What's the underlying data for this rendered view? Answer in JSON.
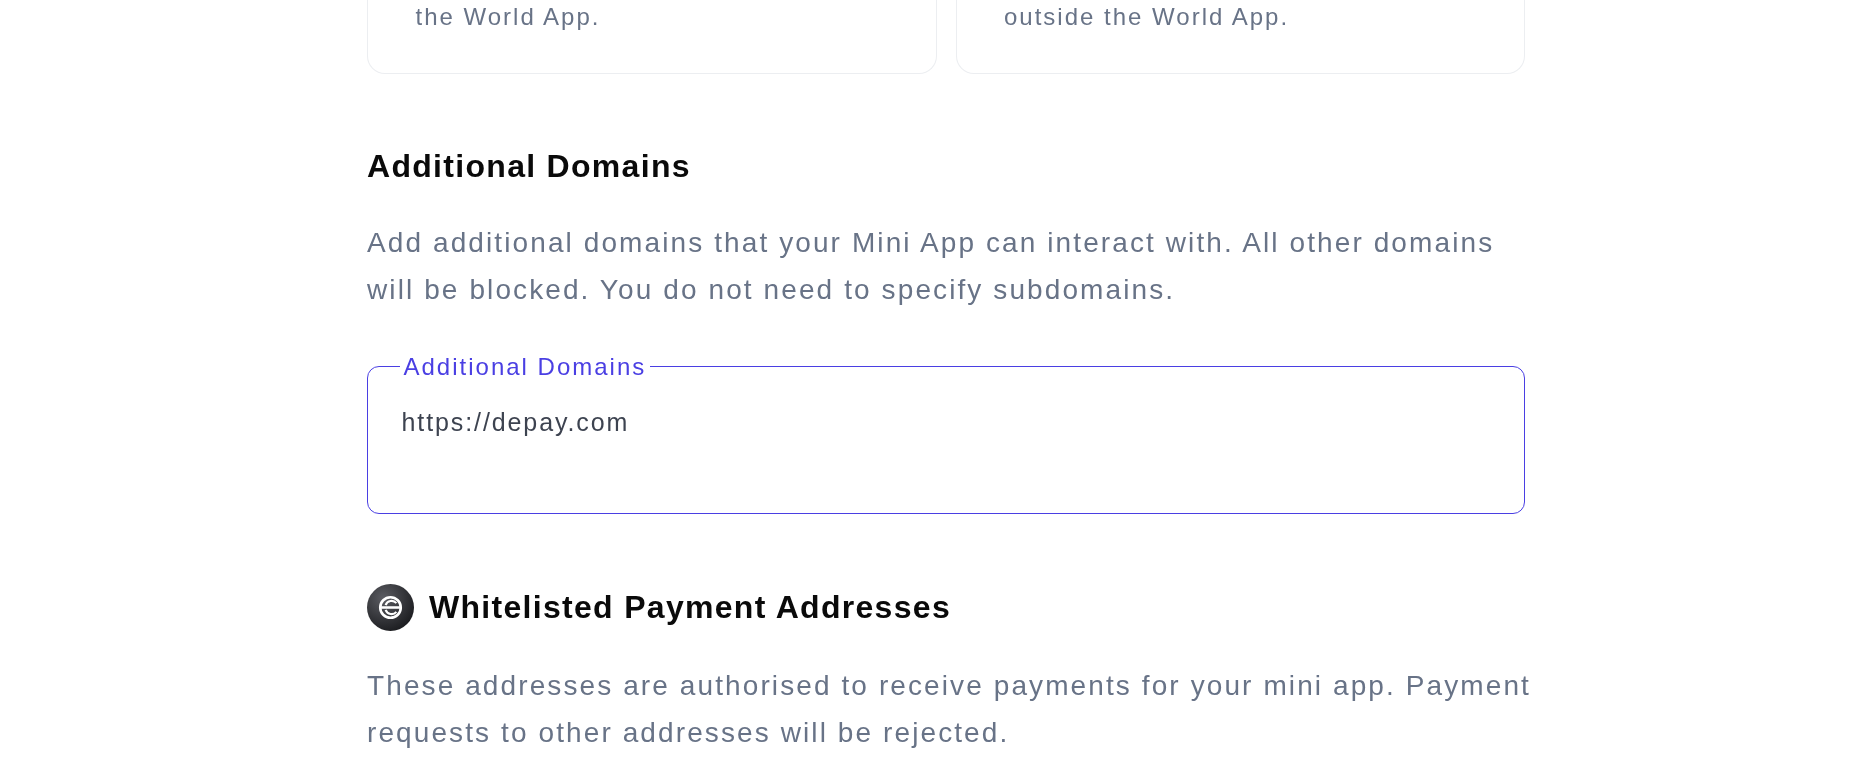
{
  "cards": [
    {
      "text": "the World App."
    },
    {
      "text": "outside the World App."
    }
  ],
  "domains_section": {
    "title": "Additional Domains",
    "description": "Add additional domains that your Mini App can interact with. All other domains will be blocked. You do not need to specify subdomains.",
    "field": {
      "label": "Additional Domains",
      "value": "https://depay.com",
      "focused": true
    }
  },
  "payments_section": {
    "title": "Whitelisted Payment Addresses",
    "description": "These addresses are authorised to receive payments for your mini app. Payment requests to other addresses will be rejected."
  }
}
